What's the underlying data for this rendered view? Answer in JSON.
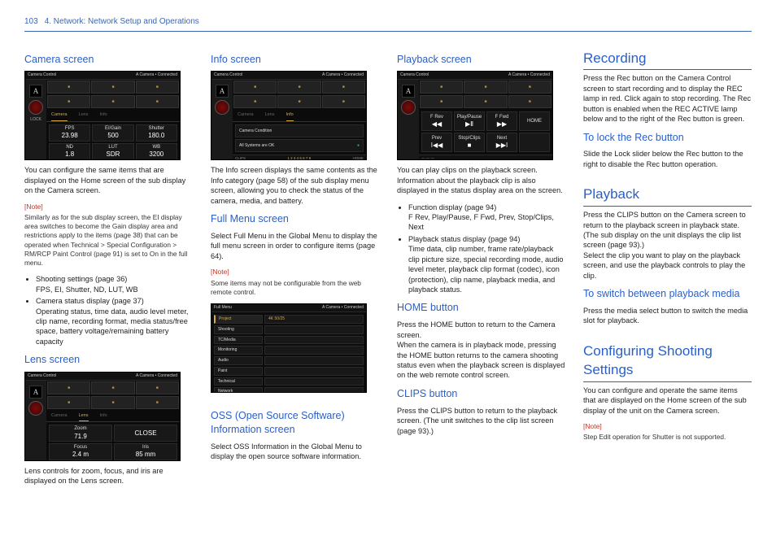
{
  "header": {
    "page_number": "103",
    "breadcrumb": "4. Network: Network Setup and Operations"
  },
  "col1": {
    "camera_screen": {
      "title": "Camera screen",
      "body": "You can configure the same items that are displayed on the Home screen of the sub display on the Camera screen.",
      "note_label": "[Note]",
      "note": "Similarly as for the sub display screen, the EI display area switches to become the Gain display area and restrictions apply to the items (page 38) that can be operated when Technical > Special Configuration > RM/RCP Paint Control (page 91) is set to On in the full menu.",
      "bullets": [
        {
          "main": "Shooting settings (page 36)",
          "sub": "FPS, EI, Shutter, ND, LUT, WB"
        },
        {
          "main": "Camera status display (page 37)",
          "sub": "Operating status, time data, audio level meter, clip name, recording format, media status/free space, battery voltage/remaining battery capacity"
        }
      ]
    },
    "lens_screen": {
      "title": "Lens screen",
      "body": "Lens controls for zoom, focus, and iris are displayed on the Lens screen."
    }
  },
  "col2": {
    "info_screen": {
      "title": "Info screen",
      "body": "The Info screen displays the same contents as the Info category (page 58) of the sub display menu screen, allowing you to check the status of the camera, media, and battery."
    },
    "full_menu": {
      "title": "Full Menu screen",
      "body": "Select Full Menu in the Global Menu to display the full menu screen in order to configure items (page 64).",
      "note_label": "[Note]",
      "note": "Some items may not be configurable from the web remote control."
    },
    "oss": {
      "title": "OSS (Open Source Software) Information screen",
      "body": "Select OSS Information in the Global Menu to display the open source software information."
    }
  },
  "col3": {
    "playback_screen": {
      "title": "Playback screen",
      "body": "You can play clips on the playback screen. Information about the playback clip is also displayed in the status display area on the screen.",
      "bullets": [
        {
          "main": "Function display (page 94)",
          "sub": "F Rev, Play/Pause, F Fwd, Prev, Stop/Clips, Next"
        },
        {
          "main": "Playback status display (page 94)",
          "sub": "Time data, clip number, frame rate/playback clip picture size, special recording mode, audio level meter, playback clip format (codec), icon (protection), clip name, playback media, and playback status."
        }
      ]
    },
    "home_button": {
      "title": "HOME button",
      "body": "Press the HOME button to return to the Camera screen.\nWhen the camera is in playback mode, pressing the HOME button returns to the camera shooting status even when the playback screen is displayed on the web remote control screen."
    },
    "clips_button": {
      "title": "CLIPS button",
      "body": "Press the CLIPS button to return to the playback screen. (The unit switches to the clip list screen (page 93).)"
    }
  },
  "col4": {
    "recording": {
      "title": "Recording",
      "body": "Press the Rec button on the Camera Control screen to start recording and to display the REC lamp in red. Click again to stop recording. The Rec button is enabled when the REC ACTIVE lamp below and to the right of the Rec button is green.",
      "lock_title": "To lock the Rec button",
      "lock_body": "Slide the Lock slider below the Rec button to the right to disable the Rec button operation."
    },
    "playback": {
      "title": "Playback",
      "body": "Press the CLIPS button on the Camera screen to return to the playback screen in playback state. (The sub display on the unit displays the clip list screen (page 93).)\nSelect the clip you want to play on the playback screen, and use the playback controls to play the clip.",
      "switch_title": "To switch between playback media",
      "switch_body": "Press the media select button to switch the media slot for playback."
    },
    "shooting": {
      "title": "Configuring Shooting Settings",
      "body": "You can configure and operate the same items that are displayed on the Home screen of the sub display of the unit on the Camera screen.",
      "note_label": "[Note]",
      "note": "Step Edit operation for Shutter is not supported."
    }
  },
  "mock_labels": {
    "title_bar": "Camera Control",
    "status": "A Camera  • Connected",
    "tabs": {
      "camera": "Camera",
      "lens": "Lens",
      "info": "Info"
    },
    "home": "HOME",
    "clips": "CLIPS",
    "rec": "Rec",
    "a": "A",
    "lock": "LOCK",
    "full_menu": "Full Menu"
  },
  "mock_values": {
    "camera_cells": [
      {
        "top": "FPS",
        "big": "23.98"
      },
      {
        "top": "EI/Gain",
        "big": "500"
      },
      {
        "top": "Shutter",
        "big": "180.0"
      },
      {
        "top": "ND",
        "big": "1.8"
      },
      {
        "top": "LUT",
        "big": "SDR"
      },
      {
        "top": "WB",
        "big": "3200"
      }
    ],
    "lens_cells": [
      {
        "top": "Zoom",
        "big": "71.9"
      },
      {
        "top": "Focus",
        "big": "2.4 m"
      },
      {
        "top": "Iris",
        "big": "85 mm"
      },
      {
        "top": "",
        "big": "CLOSE"
      }
    ],
    "info_lines": [
      {
        "l": "Camera Condition",
        "r": ""
      },
      {
        "l": "All Systems are OK",
        "r": "●"
      }
    ],
    "info_pages": "1  2  3  4  5  6  7  8",
    "menu_left": [
      "Project",
      "Shooting",
      "TC/Media",
      "Monitoring",
      "Audio",
      "Paint",
      "Technical",
      "Network"
    ],
    "menu_title": "4K 50/25",
    "playback_cells": [
      "F Rev",
      "Play/Pause",
      "F Fwd",
      "",
      "Prev",
      "Stop/Clips",
      "Next",
      ""
    ]
  }
}
